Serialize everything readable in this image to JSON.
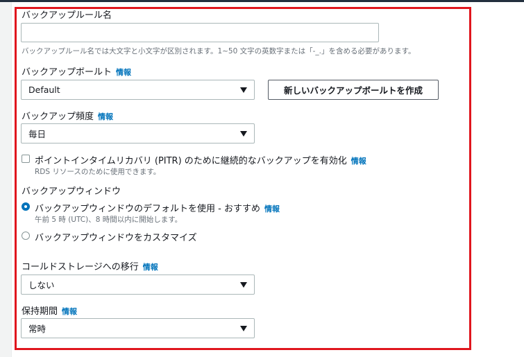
{
  "form": {
    "rule_name": {
      "label": "バックアップルール名",
      "value": "",
      "hint": "バックアップルール名では大文字と小文字が区別されます。1~50 文字の英数字または「-_.」を含める必要があります。"
    },
    "vault": {
      "label": "バックアップボールト",
      "info": "情報",
      "selected": "Default",
      "create_button": "新しいバックアップボールトを作成"
    },
    "frequency": {
      "label": "バックアップ頻度",
      "info": "情報",
      "selected": "毎日"
    },
    "pitr": {
      "label": "ポイントインタイムリカバリ (PITR) のために継続的なバックアップを有効化",
      "info": "情報",
      "hint": "RDS リソースのために使用できます。",
      "checked": false
    },
    "window": {
      "label": "バックアップウィンドウ",
      "options": [
        {
          "label": "バックアップウィンドウのデフォルトを使用 - おすすめ",
          "info": "情報",
          "hint": "午前 5 時 (UTC)、8 時間以内に開始します。",
          "checked": true
        },
        {
          "label": "バックアップウィンドウをカスタマイズ",
          "checked": false
        }
      ]
    },
    "cold_storage": {
      "label": "コールドストレージへの移行",
      "info": "情報",
      "selected": "しない"
    },
    "retention": {
      "label": "保持期間",
      "info": "情報",
      "selected": "常時"
    }
  },
  "colors": {
    "highlight_border": "#e0161e",
    "link": "#0073bb",
    "radio_selected": "#0073bb"
  }
}
